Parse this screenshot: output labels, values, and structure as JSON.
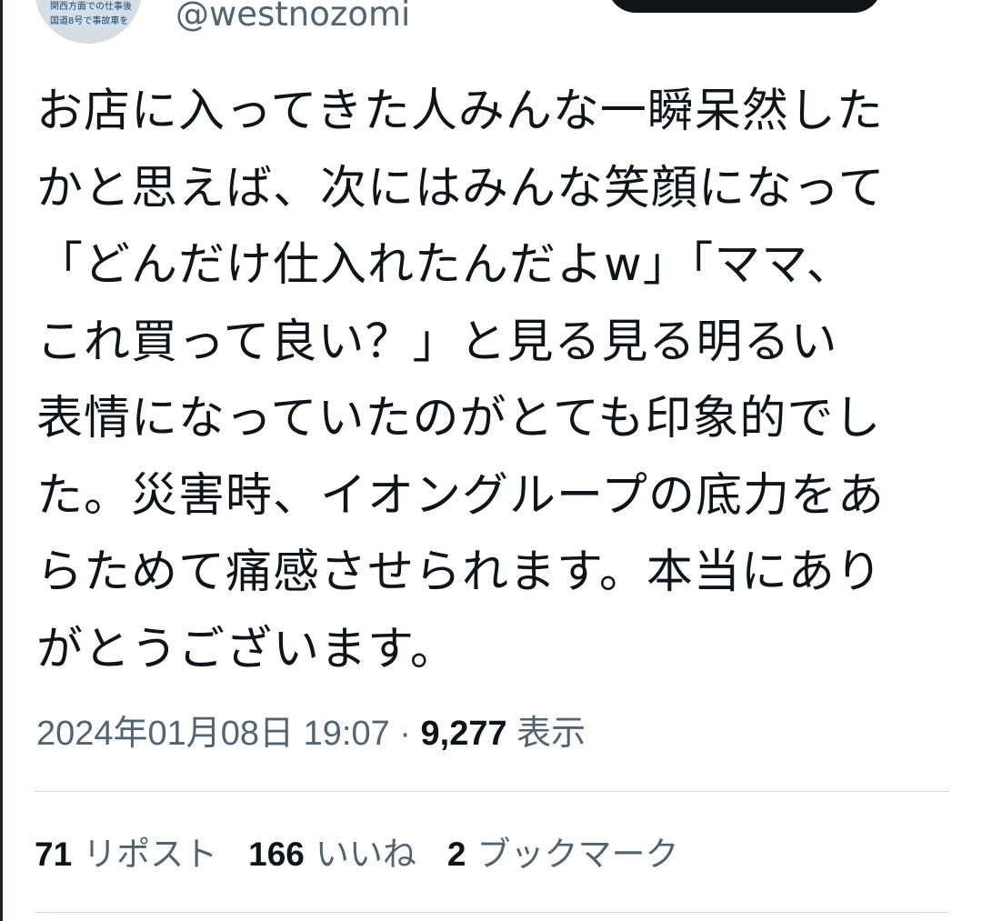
{
  "author": {
    "handle": "@westnozomi",
    "avatar_caption_line1": "関西方面での仕事後",
    "avatar_caption_line2": "国道8号で事故車を"
  },
  "tweet": {
    "lines": [
      "お店に入ってきた人みんな一瞬呆然した",
      "かと思えば、次にはみんな笑顔になって",
      "「どんだけ仕入れたんだよw」「ママ、",
      "これ買って良い？」と見る見る明るい",
      "表情になっていたのがとても印象的でし",
      "た。災害時、イオングループの底力をあ",
      "らためて痛感させられます。本当にあり",
      "がとうございます。"
    ]
  },
  "meta": {
    "datetime": "2024年01月08日 19:07",
    "separator": " · ",
    "views_count": "9,277",
    "views_label": "表示"
  },
  "stats": {
    "reposts_count": "71",
    "reposts_label": "リポスト",
    "likes_count": "166",
    "likes_label": "いいね",
    "bookmarks_count": "2",
    "bookmarks_label": "ブックマーク"
  },
  "colors": {
    "text_primary": "#0f1419",
    "text_secondary": "#536471",
    "divider": "#cfd9de",
    "button_dark": "#0f1419"
  }
}
